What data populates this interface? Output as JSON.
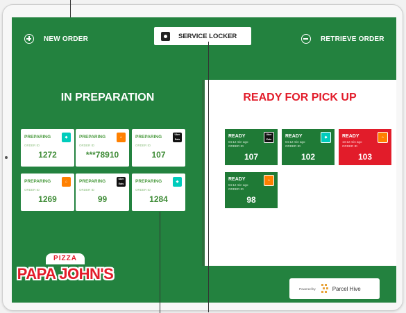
{
  "topbar": {
    "new_order_label": "NEW ORDER",
    "service_locker_label": "SERVICE LOCKER",
    "retrieve_order_label": "RETRIEVE ORDER"
  },
  "in_preparation": {
    "title": "IN PREPARATION",
    "cards": [
      {
        "status": "PREPARING",
        "order_label": "ORDER ID",
        "number": "1272",
        "logo": "deliveroo-icon"
      },
      {
        "status": "PREPARING",
        "order_label": "ORDER ID",
        "number": "***78910",
        "logo": "just-eat-icon"
      },
      {
        "status": "PREPARING",
        "order_label": "ORDER ID",
        "number": "107",
        "logo": "uber-eats-icon",
        "logo_text": "Uber Eats"
      },
      {
        "status": "PREPARING",
        "order_label": "ORDER ID",
        "number": "1269",
        "logo": "just-eat-icon"
      },
      {
        "status": "PREPARING",
        "order_label": "ORDER ID",
        "number": "99",
        "logo": "uber-eats-icon",
        "logo_text": "Uber Eats"
      },
      {
        "status": "PREPARING",
        "order_label": "ORDER ID",
        "number": "1284",
        "logo": "deliveroo-icon"
      }
    ]
  },
  "ready_for_pickup": {
    "title": "READY FOR PICK UP",
    "cards": [
      {
        "status": "READY",
        "ago": "04:12 min ago",
        "order_label": "ORDER ID",
        "number": "107",
        "logo": "uber-eats-icon",
        "logo_text": "Uber Eats",
        "color": "#1f7a36"
      },
      {
        "status": "READY",
        "ago": "04:12 min ago",
        "order_label": "ORDER ID",
        "number": "102",
        "logo": "deliveroo-icon",
        "color": "#1f7a36"
      },
      {
        "status": "READY",
        "ago": "10:12 min ago",
        "order_label": "ORDER ID",
        "number": "103",
        "logo": "just-eat-icon",
        "color": "#e21c2a"
      },
      {
        "status": "READY",
        "ago": "04:12 min ago",
        "order_label": "ORDER ID",
        "number": "98",
        "logo": "just-eat-icon",
        "color": "#1f7a36"
      }
    ]
  },
  "footer": {
    "brand_top": "PIZZA",
    "brand_name": "PAPA JOHN'S",
    "powered_by": "Powered by",
    "powered_name": "Parcel Hive"
  },
  "colors": {
    "primary_green": "#23823f",
    "ready_green": "#1f7a36",
    "alert_red": "#e21c2a"
  }
}
